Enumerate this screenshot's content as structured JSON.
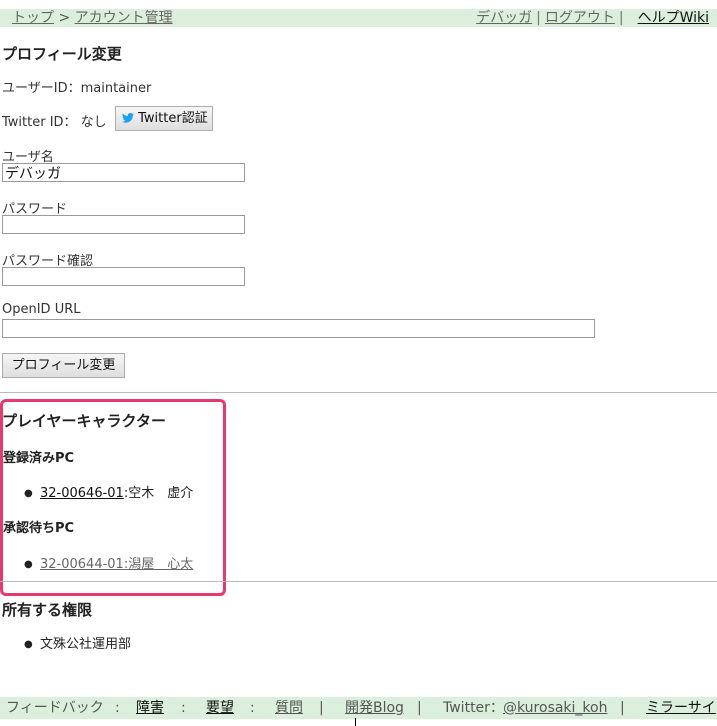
{
  "topbar": {
    "breadcrumb_home": "トップ",
    "breadcrumb_sep": ">",
    "breadcrumb_current": "アカウント管理",
    "user_link": "デバッガ",
    "sep1": "|",
    "logout_link": "ログアウト",
    "sep2": "|",
    "help_link": "ヘルプWiki"
  },
  "profile": {
    "title": "プロフィール変更",
    "user_id_label": "ユーザーID：maintainer",
    "twitter_id_label": "Twitter ID： なし",
    "twitter_button": "Twitter認証",
    "username_label": "ユーザ名",
    "username_value": "デバッガ",
    "password_label": "パスワード",
    "password_value": "",
    "password_confirm_label": "パスワード確認",
    "password_confirm_value": "",
    "openid_label": "OpenID URL",
    "openid_value": "",
    "submit_button": "プロフィール変更"
  },
  "characters": {
    "title": "プレイヤーキャラクター",
    "registered_label": "登録済みPC",
    "registered": [
      {
        "id": "32-00646-01",
        "name": ":空木　虚介"
      }
    ],
    "pending_label": "承認待ちPC",
    "pending": [
      {
        "id": "32-00644-01",
        "name": ":潟屋　心太"
      }
    ]
  },
  "permissions": {
    "title": "所有する権限",
    "items": [
      "文殊公社運用部"
    ]
  },
  "footer": {
    "feedback": "フィードバック",
    "colon1": ":",
    "bug": "障害",
    "colon2": ":",
    "request": "要望",
    "colon3": ":",
    "question": "質問",
    "sep1": "|",
    "devblog": "開発Blog",
    "sep2": "|",
    "twitter_prefix": "Twitter：",
    "twitter_handle": "@kurosaki_koh",
    "sep3": "|",
    "mirror": "ミラーサイ"
  },
  "colors": {
    "header_bg": "#dcefdc",
    "highlight": "#e8386f",
    "twitter_blue": "#1da1f2"
  }
}
